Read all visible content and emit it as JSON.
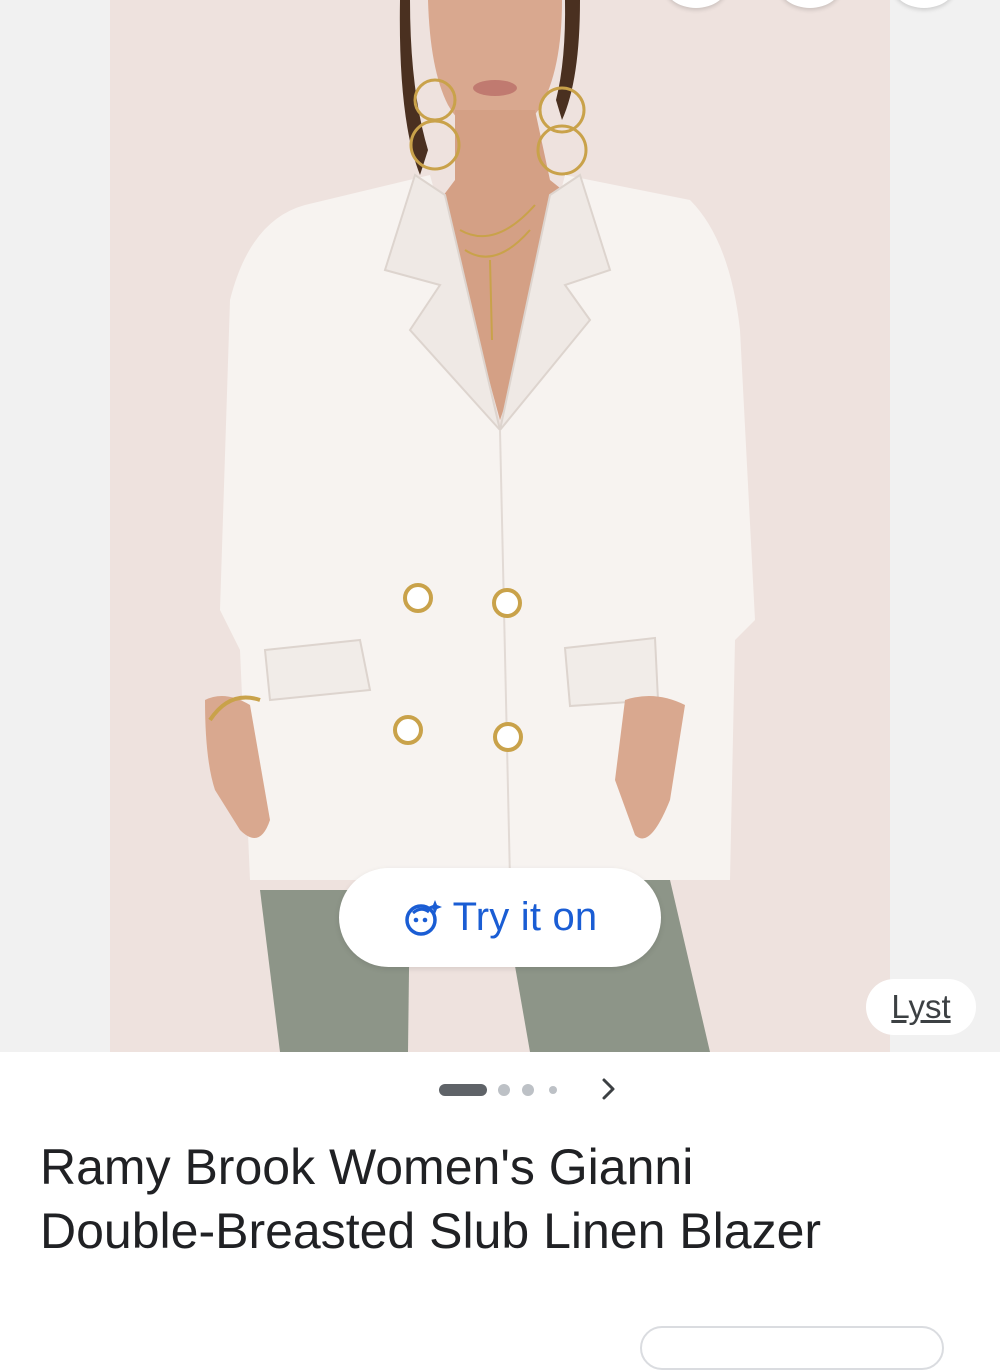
{
  "product": {
    "image_alt": "Model wearing a white double-breasted blazer",
    "try_on_label": "Try it on",
    "source_label": "Lyst",
    "title_line1": "Ramy Brook Women's Gianni",
    "title_line2": "Double-Breasted Slub Linen Blazer"
  },
  "carousel": {
    "total_dots": 4,
    "active_index": 0
  },
  "icons": {
    "try_on": "face-sparkle-icon",
    "next": "chevron-right-icon"
  },
  "colors": {
    "accent": "#1a5dd4",
    "title": "#202124",
    "dot_active": "#5f6368",
    "dot_inactive": "#bdc1c6"
  }
}
